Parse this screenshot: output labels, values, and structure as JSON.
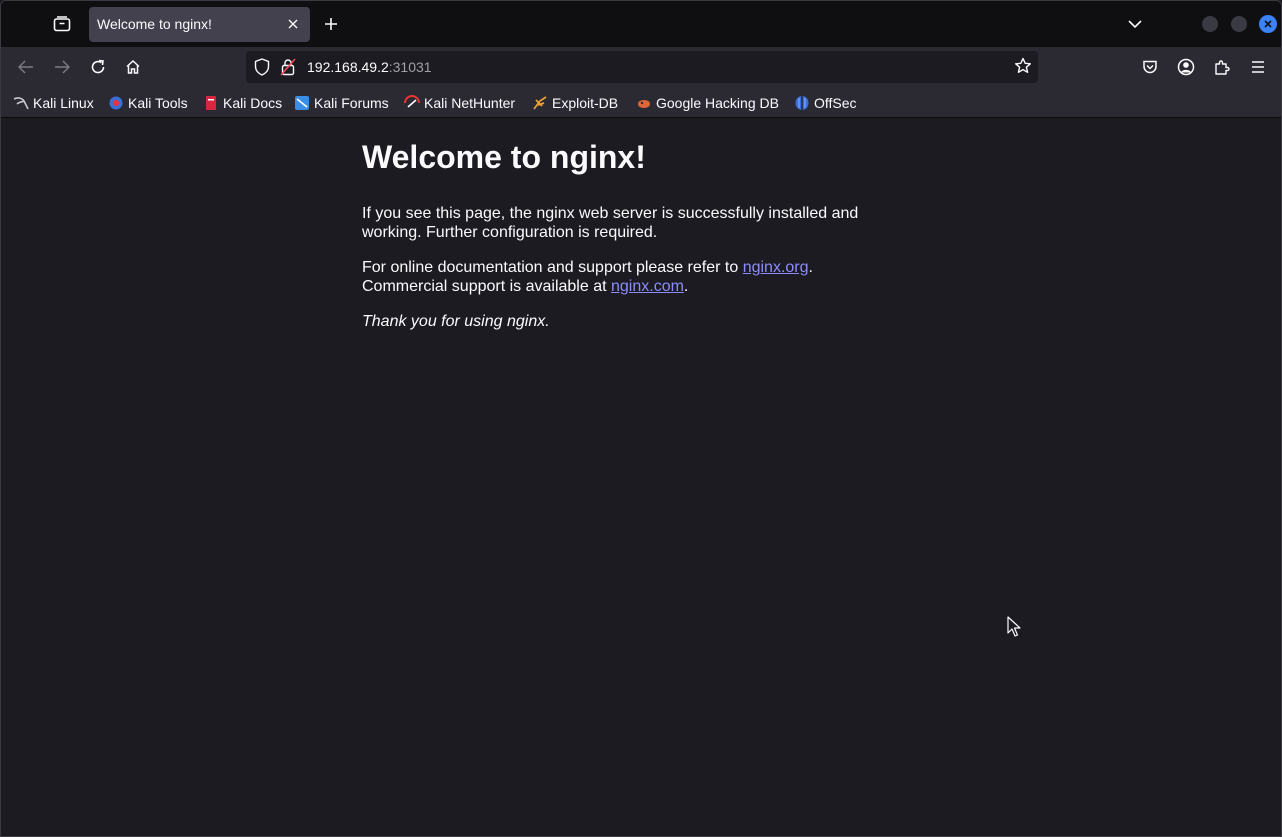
{
  "browser": {
    "tab": {
      "title": "Welcome to nginx!"
    },
    "url": {
      "host": "192.168.49.2",
      "port": ":31031"
    },
    "bookmarks": [
      {
        "label": "Kali Linux",
        "icon": "kali-dragon-icon"
      },
      {
        "label": "Kali Tools",
        "icon": "kali-tools-icon"
      },
      {
        "label": "Kali Docs",
        "icon": "kali-docs-icon"
      },
      {
        "label": "Kali Forums",
        "icon": "kali-forums-icon"
      },
      {
        "label": "Kali NetHunter",
        "icon": "kali-nethunter-icon"
      },
      {
        "label": "Exploit-DB",
        "icon": "exploit-db-icon"
      },
      {
        "label": "Google Hacking DB",
        "icon": "ghdb-icon"
      },
      {
        "label": "OffSec",
        "icon": "offsec-icon"
      }
    ],
    "colors": {
      "tabstrip": "#0f0f12",
      "toolbar": "#2b2a33",
      "content": "#1c1b22",
      "link": "#8c8cff",
      "close_button": "#3b82f6"
    }
  },
  "page": {
    "heading": "Welcome to nginx!",
    "p1": "If you see this page, the nginx web server is successfully installed and working. Further configuration is required.",
    "p2_prefix": "For online documentation and support please refer to ",
    "link1": "nginx.org",
    "p2_mid": ".",
    "p2_line2": "Commercial support is available at ",
    "link2": "nginx.com",
    "p2_end": ".",
    "thanks": "Thank you for using nginx."
  }
}
